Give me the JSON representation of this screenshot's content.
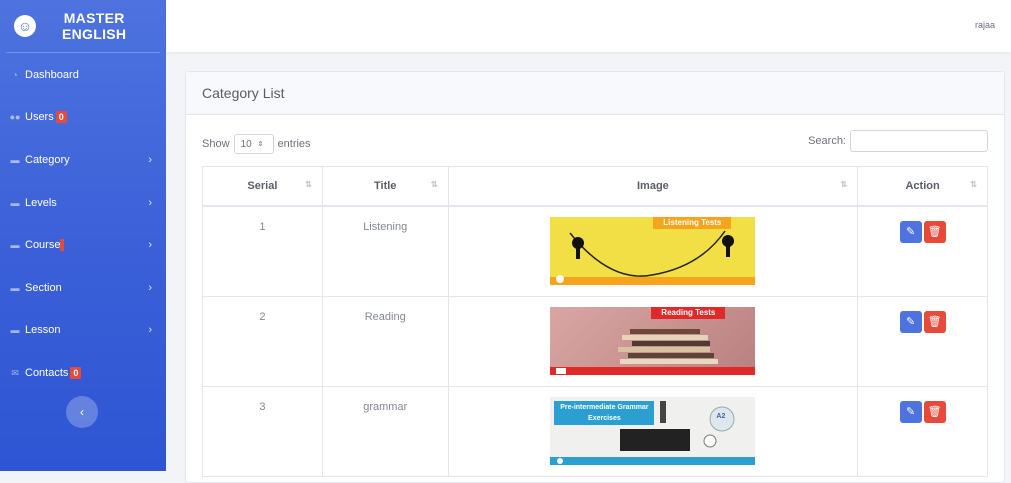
{
  "brand": {
    "line1": "MASTER",
    "line2": "ENGLISH",
    "logo_icon": "smile-wink-icon"
  },
  "sidebar": {
    "items": [
      {
        "label": "Dashboard",
        "icon": "tachometer-icon",
        "badge": null,
        "chevron": false
      },
      {
        "label": "Users",
        "icon": "users-icon",
        "badge": "0",
        "chevron": false
      },
      {
        "label": "Category",
        "icon": "folder-icon",
        "badge": null,
        "chevron": true
      },
      {
        "label": "Levels",
        "icon": "folder-icon",
        "badge": null,
        "chevron": true
      },
      {
        "label": "Course",
        "icon": "folder-icon",
        "badge": "",
        "chevron": true
      },
      {
        "label": "Section",
        "icon": "folder-icon",
        "badge": null,
        "chevron": true
      },
      {
        "label": "Lesson",
        "icon": "folder-icon",
        "badge": null,
        "chevron": true
      },
      {
        "label": "Contacts",
        "icon": "envelope-icon",
        "badge": "0",
        "chevron": false
      }
    ],
    "toggle_icon": "chevron-left-icon"
  },
  "topbar": {
    "user": "rajaa"
  },
  "card": {
    "title": "Category List"
  },
  "controls": {
    "show_label": "Show",
    "entries_value": "10",
    "entries_label": "entries",
    "search_label": "Search:",
    "search_value": ""
  },
  "table": {
    "headers": [
      "Serial",
      "Title",
      "Image",
      "Action"
    ],
    "rows": [
      {
        "serial": "1",
        "title": "Listening",
        "image_text": "Listening Tests"
      },
      {
        "serial": "2",
        "title": "Reading",
        "image_text": "Reading Tests"
      },
      {
        "serial": "3",
        "title": "grammar",
        "image_text": "Pre-intermediate Grammar Exercises",
        "image_badge": "A2"
      }
    ]
  },
  "colors": {
    "sidebar": "#4e73df",
    "edit": "#4e73df",
    "delete": "#e74a3b",
    "badge": "#e74a3b"
  }
}
